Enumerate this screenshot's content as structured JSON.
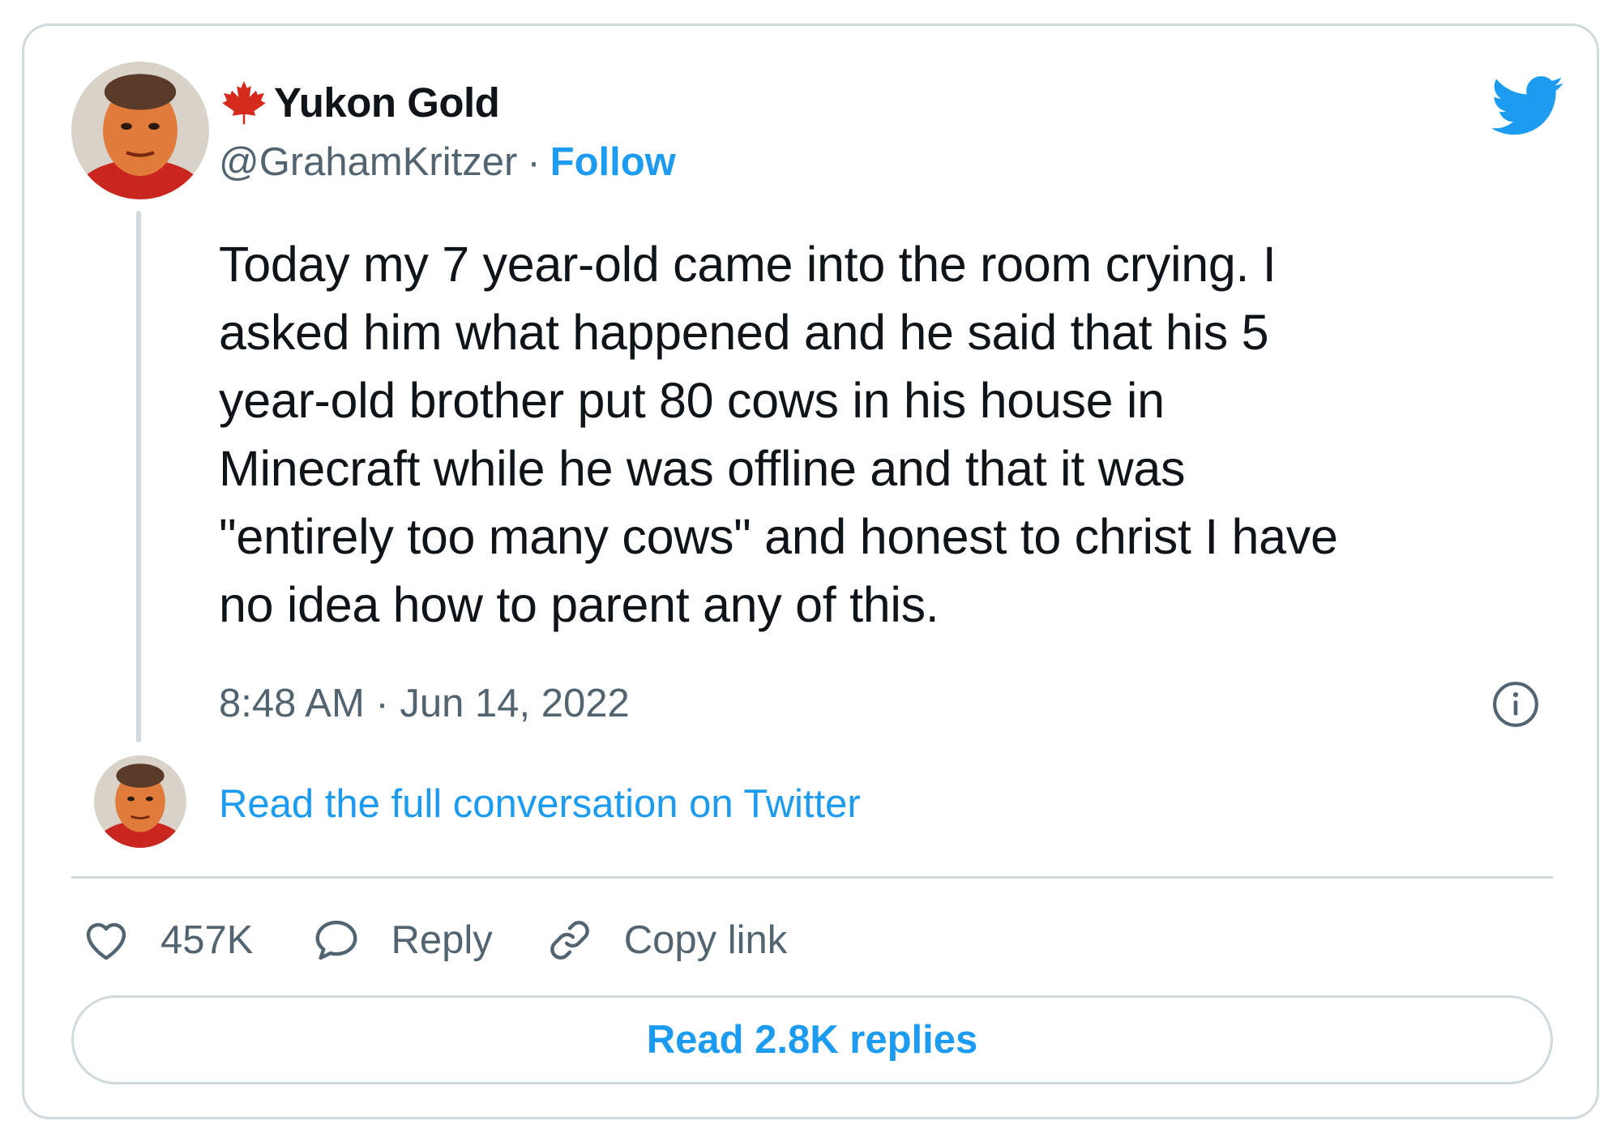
{
  "author": {
    "display_name": "Yukon Gold",
    "handle": "@GrahamKritzer",
    "separator": "·",
    "follow_label": "Follow",
    "flag_icon": "maple-leaf-icon",
    "avatar_alt": "profile photo"
  },
  "tweet": {
    "text": "Today my 7 year-old came into the room crying. I\nasked him what happened and he said that his 5\nyear-old brother put 80 cows in his house in\nMinecraft while he was offline and that it was\n\"entirely too many cows\" and honest to christ I have\nno idea how to parent any of this.",
    "time": "8:48 AM",
    "separator": "·",
    "date": "Jun 14, 2022"
  },
  "conversation_link": "Read the full conversation on Twitter",
  "actions": {
    "like_count": "457K",
    "reply_label": "Reply",
    "copy_link_label": "Copy link"
  },
  "read_replies_label": "Read 2.8K replies",
  "colors": {
    "link_blue": "#1d9bf0",
    "secondary_text": "#536471",
    "border": "#cfd9de",
    "maple_red": "#d52b1e"
  },
  "icons": [
    "maple-leaf-icon",
    "twitter-bird-icon",
    "info-icon",
    "heart-icon",
    "reply-bubble-icon",
    "link-icon"
  ]
}
